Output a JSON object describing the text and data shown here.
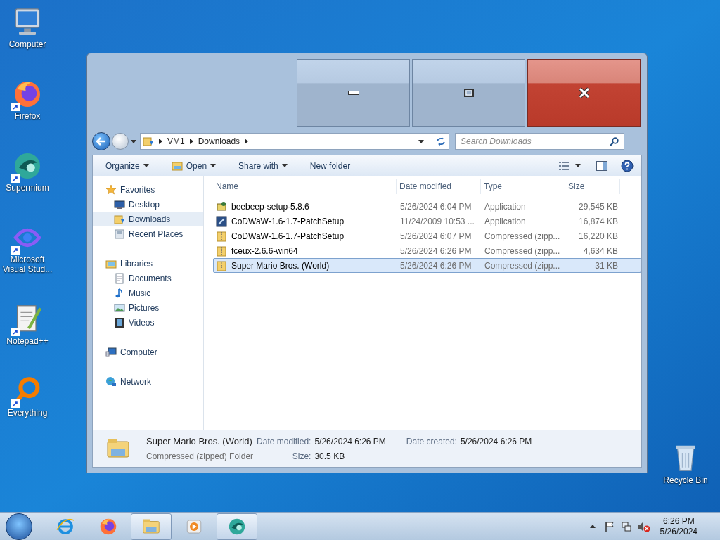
{
  "desktop_icons": [
    {
      "label": "Computer",
      "kind": "computer",
      "shortcut": false
    },
    {
      "label": "Firefox",
      "kind": "firefox",
      "shortcut": true
    },
    {
      "label": "Supermium",
      "kind": "supermium",
      "shortcut": true
    },
    {
      "label": "Microsoft Visual Stud...",
      "kind": "visualstudio",
      "shortcut": true
    },
    {
      "label": "Notepad++",
      "kind": "notepad",
      "shortcut": true
    },
    {
      "label": "Everything",
      "kind": "everything",
      "shortcut": true
    }
  ],
  "recycle_bin": {
    "label": "Recycle Bin"
  },
  "window": {
    "address": {
      "crumbs": [
        "VM1",
        "Downloads"
      ]
    },
    "search": {
      "placeholder": "Search Downloads"
    },
    "toolbar": [
      {
        "label": "Organize",
        "dropdown": true,
        "kind": "plain"
      },
      {
        "label": "Open",
        "dropdown": true,
        "kind": "open"
      },
      {
        "label": "Share with",
        "dropdown": true,
        "kind": "plain"
      },
      {
        "label": "New folder",
        "dropdown": false,
        "kind": "plain"
      }
    ],
    "nav": [
      {
        "label": "Favorites",
        "kind": "star",
        "children": [
          {
            "label": "Desktop",
            "kind": "desktop",
            "selected": false
          },
          {
            "label": "Downloads",
            "kind": "downloads",
            "selected": true
          },
          {
            "label": "Recent Places",
            "kind": "recent",
            "selected": false
          }
        ]
      },
      {
        "label": "Libraries",
        "kind": "library",
        "children": [
          {
            "label": "Documents",
            "kind": "document",
            "selected": false
          },
          {
            "label": "Music",
            "kind": "music",
            "selected": false
          },
          {
            "label": "Pictures",
            "kind": "pictures",
            "selected": false
          },
          {
            "label": "Videos",
            "kind": "videos",
            "selected": false
          }
        ]
      },
      {
        "label": "Computer",
        "kind": "computer"
      },
      {
        "label": "Network",
        "kind": "network"
      }
    ],
    "columns": [
      "Name",
      "Date modified",
      "Type",
      "Size"
    ],
    "rows": [
      {
        "kind": "installer",
        "name": "beebeep-setup-5.8.6",
        "date": "5/26/2024 6:04 PM",
        "type": "Application",
        "size": "29,545 KB",
        "selected": false
      },
      {
        "kind": "app",
        "name": "CoDWaW-1.6-1.7-PatchSetup",
        "date": "11/24/2009 10:53 ...",
        "type": "Application",
        "size": "16,874 KB",
        "selected": false
      },
      {
        "kind": "zip",
        "name": "CoDWaW-1.6-1.7-PatchSetup",
        "date": "5/26/2024 6:07 PM",
        "type": "Compressed (zipp...",
        "size": "16,220 KB",
        "selected": false
      },
      {
        "kind": "zip",
        "name": "fceux-2.6.6-win64",
        "date": "5/26/2024 6:26 PM",
        "type": "Compressed (zipp...",
        "size": "4,634 KB",
        "selected": false
      },
      {
        "kind": "zip",
        "name": "Super Mario Bros. (World)",
        "date": "5/26/2024 6:26 PM",
        "type": "Compressed (zipp...",
        "size": "31 KB",
        "selected": true
      }
    ],
    "details": {
      "name": "Super Mario Bros. (World)",
      "type": "Compressed (zipped) Folder",
      "fields": [
        {
          "label": "Date modified:",
          "value": "5/26/2024 6:26 PM"
        },
        {
          "label": "Size:",
          "value": "30.5 KB"
        },
        {
          "label": "Date created:",
          "value": "5/26/2024 6:26 PM"
        }
      ]
    }
  },
  "taskbar": {
    "items": [
      {
        "kind": "ie",
        "active": false
      },
      {
        "kind": "firefox",
        "active": false
      },
      {
        "kind": "explorer",
        "active": true
      },
      {
        "kind": "media",
        "active": false
      },
      {
        "kind": "supermium",
        "active": true
      }
    ],
    "time": "6:26 PM",
    "date": "5/26/2024"
  }
}
